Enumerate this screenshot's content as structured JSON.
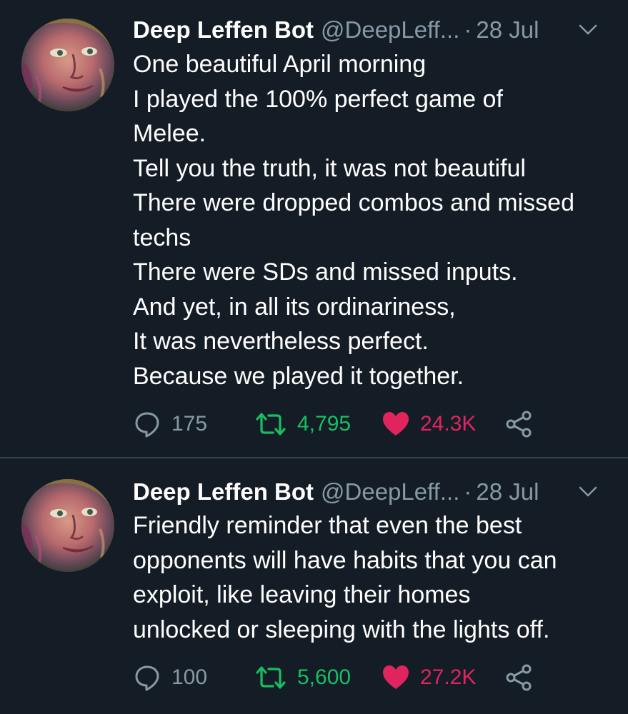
{
  "tweets": [
    {
      "display_name": "Deep Leffen Bot",
      "handle": "@DeepLeff...",
      "separator": "·",
      "date": "28 Jul",
      "lines": [
        "One beautiful April morning",
        "I played the 100% perfect game of",
        "Melee.",
        "Tell you the truth, it was not beautiful",
        "There were dropped combos and missed",
        "techs",
        "There were SDs and missed inputs.",
        "And yet, in all its ordinariness,",
        "It was nevertheless perfect.",
        "Because we played it together."
      ],
      "replies": "175",
      "retweets": "4,795",
      "likes": "24.3K"
    },
    {
      "display_name": "Deep Leffen Bot",
      "handle": "@DeepLeff...",
      "separator": "·",
      "date": "28 Jul",
      "lines": [
        "Friendly reminder that even the best",
        "opponents will have habits that you can",
        "exploit, like leaving their homes",
        "unlocked or sleeping with the lights off."
      ],
      "replies": "100",
      "retweets": "5,600",
      "likes": "27.2K"
    }
  ],
  "icons": {
    "reply": "reply-icon",
    "retweet": "retweet-icon",
    "like": "heart-icon",
    "share": "share-icon",
    "caret": "chevron-down-icon"
  },
  "colors": {
    "background": "#141d26",
    "secondary_text": "#8899a6",
    "retweet_green": "#17bf63",
    "like_pink": "#e0245e",
    "divider": "#38444d"
  }
}
